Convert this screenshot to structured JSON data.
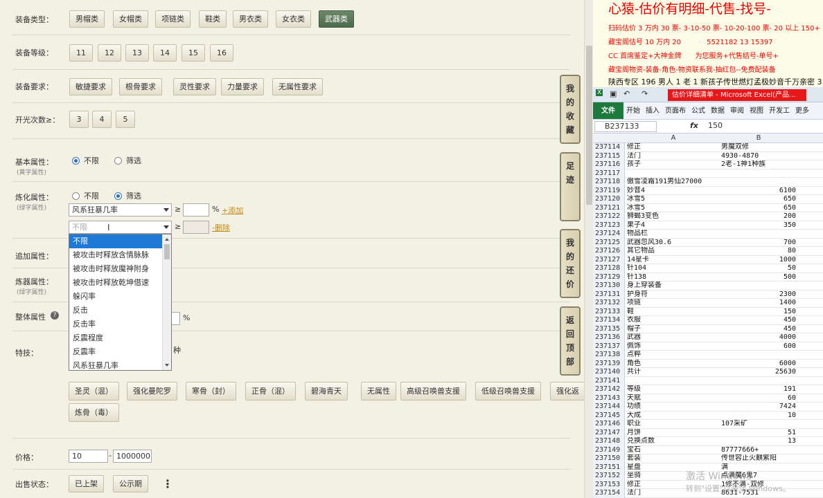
{
  "filters": {
    "type_label": "装备类型：",
    "type_options": [
      "男帽类",
      "女帽类",
      "项链类",
      "鞋类",
      "男衣类",
      "女衣类",
      "武器类"
    ],
    "type_selected": "武器类",
    "level_label": "装备等级：",
    "level_options": [
      "11",
      "12",
      "13",
      "14",
      "15",
      "16"
    ],
    "req_label": "装备要求：",
    "req_options": [
      "敏捷要求",
      "根骨要求",
      "灵性要求",
      "力量要求",
      "无属性要求"
    ],
    "open_label": "开光次数≥：",
    "open_options": [
      "3",
      "4",
      "5"
    ],
    "basic_label": "基本属性：",
    "basic_sub": "(黄字属性)",
    "refine_label": "炼化属性：",
    "refine_sub": "(绿字属性)",
    "radio_unlimited": "不限",
    "radio_filter": "筛选",
    "refine_select1": "风系狂暴几率",
    "refine_select2_placeholder": "不限",
    "ge": "≥",
    "percent": "%",
    "add_link": "+添加",
    "delete_link": "-删除",
    "extra_label": "追加属性：",
    "smelt_label": "炼器属性：",
    "smelt_sub": "(绿字属性)",
    "overall_label": "整体属性",
    "help_icon": "?",
    "overall_percent": "%",
    "skill_label": "特技：",
    "skill_partial": "种",
    "dropdown_options": [
      "不限",
      "被攻击时释放含情脉脉",
      "被攻击时释放魔神附身",
      "被攻击时释放乾坤借速",
      "躲闪率",
      "反击",
      "反击率",
      "反震程度",
      "反震率",
      "风系狂暴几率"
    ],
    "dropdown_selected": "不限",
    "skill_options_row1": [
      "圣灵（混）",
      "强化曼陀罗",
      "寒骨（封）",
      "正骨（混）",
      "碧海青天",
      "无属性",
      "高级召唤兽支援",
      "低级召唤兽支援",
      "强化返"
    ],
    "skill_options_row2": [
      "炼骨（毒）"
    ],
    "price_label": "价格：",
    "price_min": "10",
    "price_dash": "-",
    "price_max": "1000000",
    "sale_label": "出售状态：",
    "sale_options": [
      "已上架",
      "公示期"
    ],
    "more_icon": "⋮"
  },
  "side_tabs": [
    "我的收藏",
    "足迹",
    "我的还价",
    "返回顶部"
  ],
  "banner": {
    "title": "心猿-估价有明细-代售-找号-",
    "line1": "扫码估价 3 万内 30 票- 3-10-50 票- 10-20-100 票- 20 以上 150+",
    "line2": "藏宝阁估号 10 万内 20 ",
    "line2_tail": "5521182 13 15397",
    "line3": "CC 首席鉴定+大神金牌",
    "line3_tail": "为您服务+代售结号-单号+",
    "line4": "藏宝阁物资-装备-角色-物资联系我-抽红包--免费配装备",
    "line5": "陕西专区 196 男人 1 老 1 新孩子传世燃灯孟极妙音千万亲密 3"
  },
  "excel": {
    "window_title": "估价详细清单 - Microsoft Excel(产品...",
    "ribbon_tabs": [
      "文件",
      "开始",
      "插入",
      "页面布",
      "公式",
      "数据",
      "审阅",
      "视图",
      "开发工",
      "更多"
    ],
    "name_box": "B237133",
    "fx": "fx",
    "formula_value": "150",
    "col_a": "A",
    "col_b": "B",
    "rows": [
      {
        "n": "237114",
        "a": "修正",
        "b": "男魔双修",
        "num": false
      },
      {
        "n": "237115",
        "a": "法门",
        "b": "4930-4870",
        "num": false
      },
      {
        "n": "237116",
        "a": "孩子",
        "b": "2老-1神1种族",
        "num": false
      },
      {
        "n": "237117",
        "a": "",
        "b": "",
        "num": false
      },
      {
        "n": "237118",
        "a": "傲雪凌霜191男仙27000",
        "b": "",
        "num": false
      },
      {
        "n": "237119",
        "a": "妙音4",
        "b": "6100",
        "num": true
      },
      {
        "n": "237120",
        "a": "冰雪5",
        "b": "650",
        "num": true
      },
      {
        "n": "237121",
        "a": "冰雪5",
        "b": "650",
        "num": true
      },
      {
        "n": "237122",
        "a": "狮蝎3变色",
        "b": "200",
        "num": true
      },
      {
        "n": "237123",
        "a": "果子4",
        "b": "350",
        "num": true
      },
      {
        "n": "237124",
        "a": "物品栏",
        "b": "",
        "num": false
      },
      {
        "n": "237125",
        "a": "武器忽风30.6",
        "b": "700",
        "num": true
      },
      {
        "n": "237126",
        "a": "其它物品",
        "b": "80",
        "num": true
      },
      {
        "n": "237127",
        "a": "14星卡",
        "b": "1000",
        "num": true
      },
      {
        "n": "237128",
        "a": "针104",
        "b": "50",
        "num": true
      },
      {
        "n": "237129",
        "a": "针138",
        "b": "500",
        "num": true
      },
      {
        "n": "237130",
        "a": "身上穿装备",
        "b": "",
        "num": false
      },
      {
        "n": "237131",
        "a": "护身符",
        "b": "2300",
        "num": true
      },
      {
        "n": "237132",
        "a": "项链",
        "b": "1400",
        "num": true
      },
      {
        "n": "237133",
        "a": "鞋",
        "b": "150",
        "num": true
      },
      {
        "n": "237134",
        "a": "衣服",
        "b": "450",
        "num": true
      },
      {
        "n": "237135",
        "a": "帽子",
        "b": "450",
        "num": true
      },
      {
        "n": "237136",
        "a": "武器",
        "b": "4000",
        "num": true
      },
      {
        "n": "237137",
        "a": "佩饰",
        "b": "600",
        "num": true
      },
      {
        "n": "237138",
        "a": "点粹",
        "b": "",
        "num": false
      },
      {
        "n": "237139",
        "a": "角色",
        "b": "6000",
        "num": true
      },
      {
        "n": "237140",
        "a": "共计",
        "b": "25630",
        "num": true
      },
      {
        "n": "237141",
        "a": "",
        "b": "",
        "num": false
      },
      {
        "n": "237142",
        "a": "等级",
        "b": "191",
        "num": true
      },
      {
        "n": "237143",
        "a": "天赋",
        "b": "60",
        "num": true
      },
      {
        "n": "237144",
        "a": "功绩",
        "b": "7424",
        "num": true
      },
      {
        "n": "237145",
        "a": "大成",
        "b": "10",
        "num": true
      },
      {
        "n": "237146",
        "a": "职业",
        "b": "107采矿",
        "num": false
      },
      {
        "n": "237147",
        "a": "月饼",
        "b": "51",
        "num": true
      },
      {
        "n": "237148",
        "a": "兑换点数",
        "b": "13",
        "num": true
      },
      {
        "n": "237149",
        "a": "宝石",
        "b": "87777666+",
        "num": false
      },
      {
        "n": "237150",
        "a": "套装",
        "b": "传世容止火麒紫阳",
        "num": false
      },
      {
        "n": "237151",
        "a": "星盘",
        "b": "满",
        "num": false
      },
      {
        "n": "237152",
        "a": "坐骑",
        "b": "点满魔6鬼7",
        "num": false
      },
      {
        "n": "237153",
        "a": "修正",
        "b": "1修不满-双修",
        "num": false
      },
      {
        "n": "237154",
        "a": "法门",
        "b": "8631-7531",
        "num": false
      }
    ]
  },
  "watermark": {
    "line1": "激活 Windows",
    "line2": "转到\"设置\"以激活 Windows。"
  }
}
